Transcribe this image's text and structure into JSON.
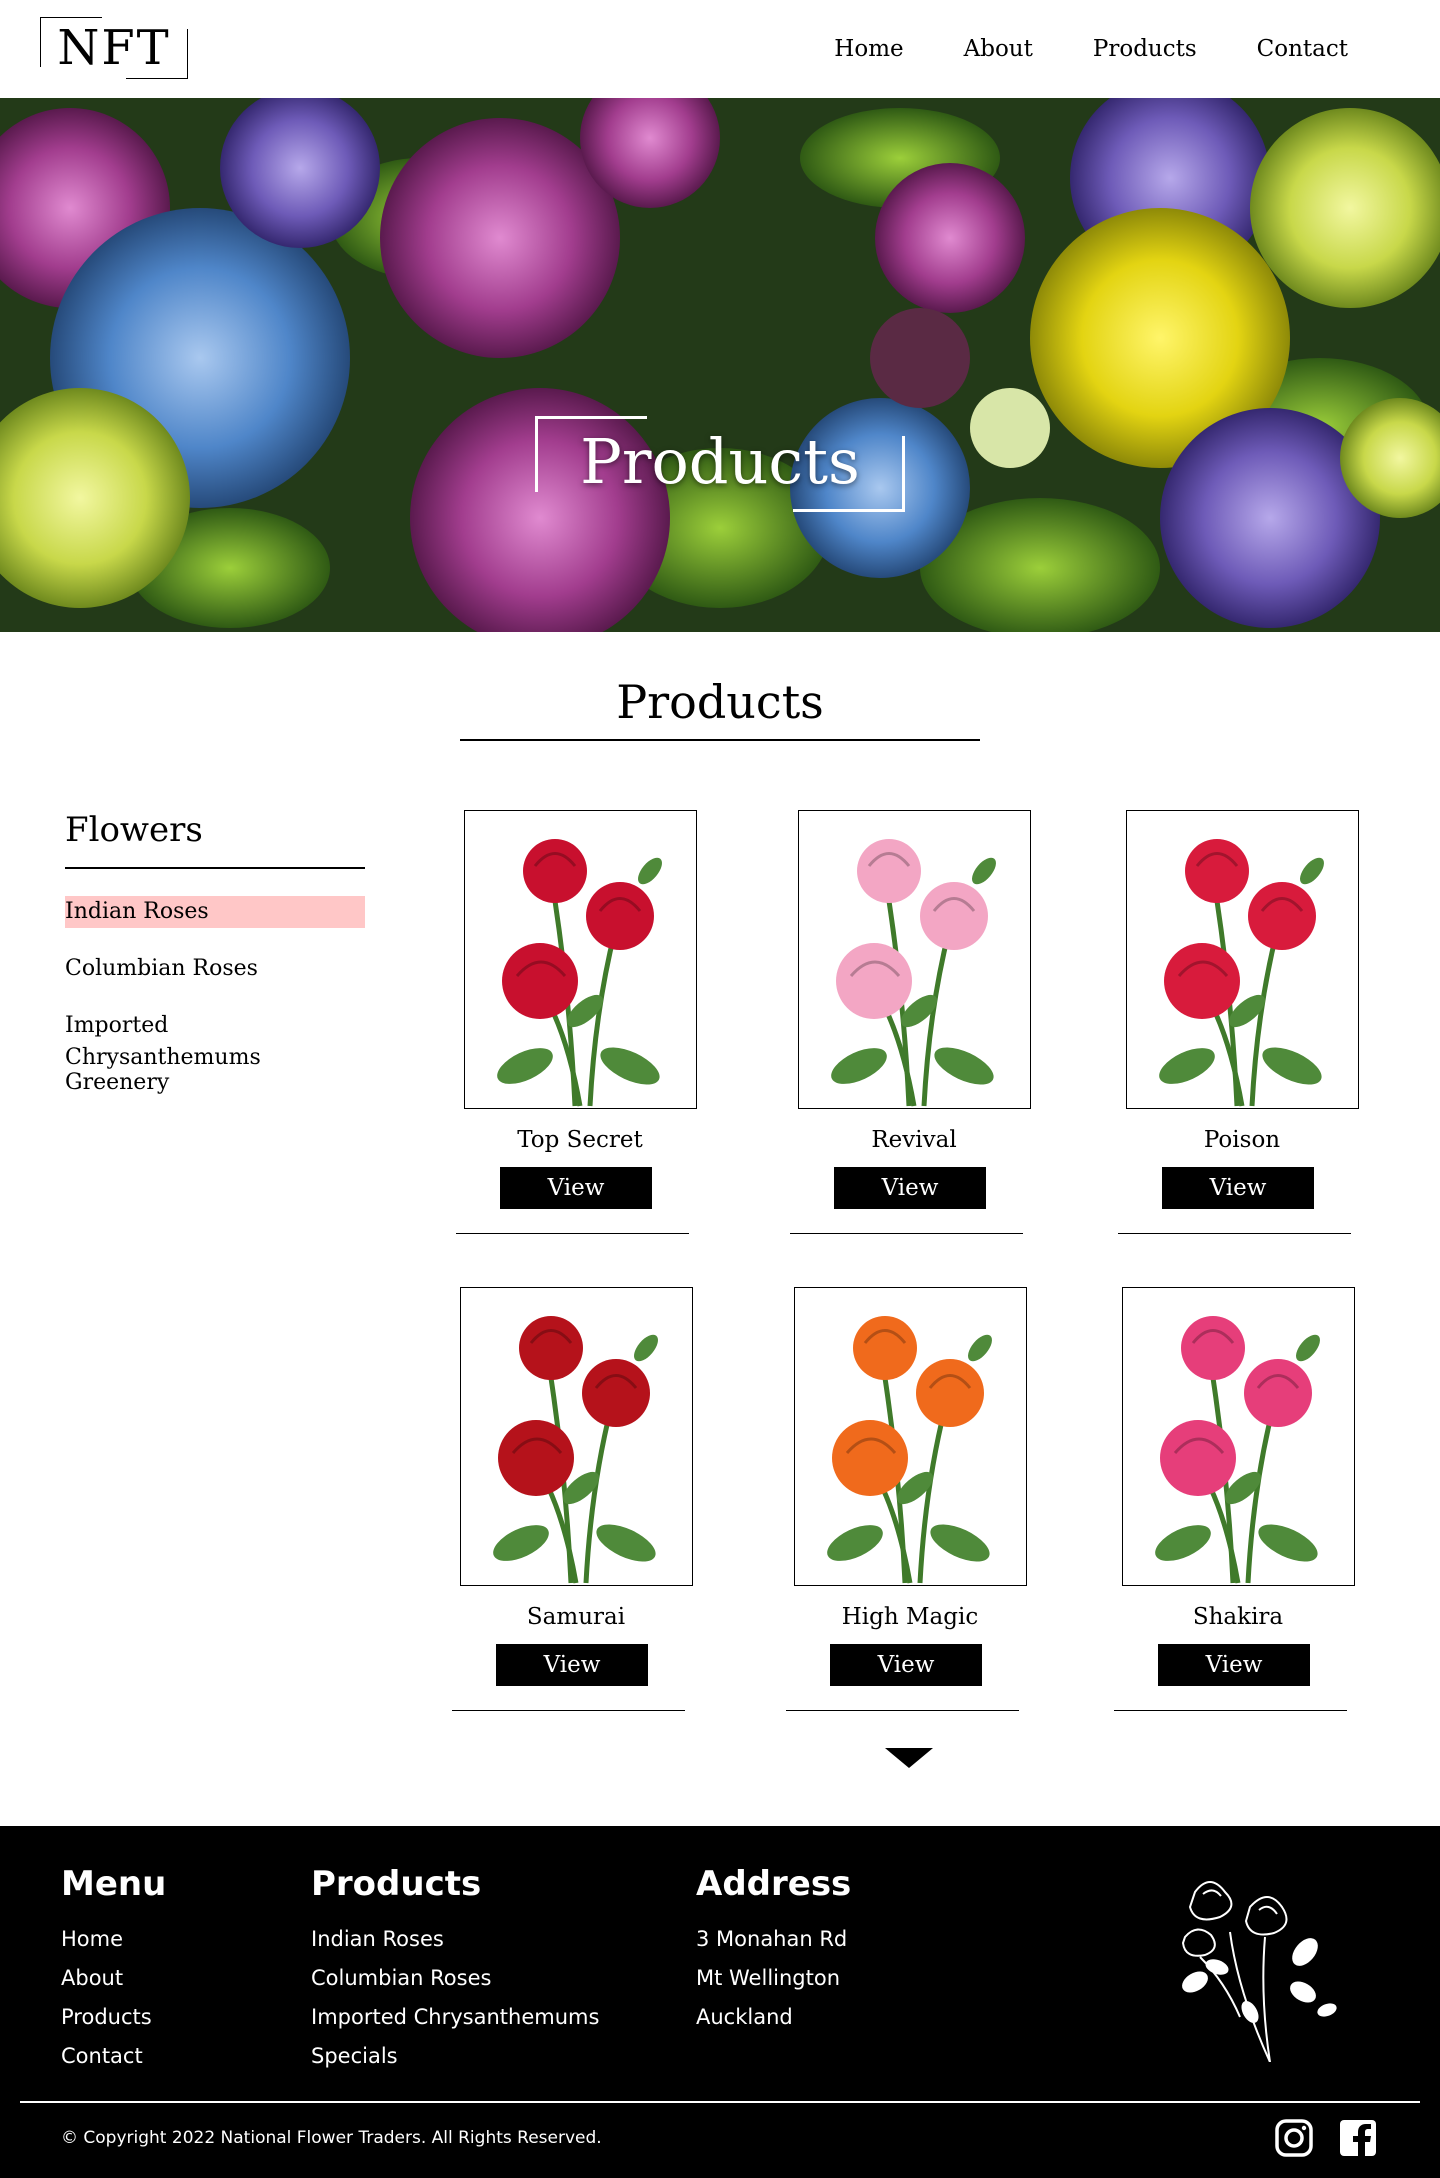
{
  "header": {
    "logo_text": "NFT",
    "nav": [
      "Home",
      "About",
      "Products",
      "Contact"
    ]
  },
  "hero": {
    "title": "Products"
  },
  "section": {
    "title": "Products"
  },
  "sidebar": {
    "title": "Flowers",
    "items": [
      "Indian Roses",
      "Columbian Roses",
      "Imported Chrysanthemums",
      "Greenery"
    ],
    "active_index": 0
  },
  "products": [
    {
      "name": "Top Secret",
      "button": "View",
      "color": "#c8102e"
    },
    {
      "name": "Revival",
      "button": "View",
      "color": "#f3a6c4"
    },
    {
      "name": "Poison",
      "button": "View",
      "color": "#d81b3c"
    },
    {
      "name": "Samurai",
      "button": "View",
      "color": "#b5121b"
    },
    {
      "name": "High Magic",
      "button": "View",
      "color": "#f06a1c"
    },
    {
      "name": "Shakira",
      "button": "View",
      "color": "#e63e7a"
    }
  ],
  "footer": {
    "menu": {
      "title": "Menu",
      "items": [
        "Home",
        "About",
        "Products",
        "Contact"
      ]
    },
    "products": {
      "title": "Products",
      "items": [
        "Indian Roses",
        "Columbian Roses",
        "Imported Chrysanthemums",
        "Specials"
      ]
    },
    "address": {
      "title": "Address",
      "lines": [
        "3 Monahan Rd",
        "Mt Wellington",
        "Auckland"
      ]
    },
    "copyright": "© Copyright 2022 National Flower Traders. All Rights Reserved.",
    "social_icons": [
      "instagram-icon",
      "facebook-icon"
    ]
  },
  "colors": {
    "active_highlight": "#ffc7c7",
    "footer_bg": "#000000",
    "button_bg": "#000000"
  }
}
